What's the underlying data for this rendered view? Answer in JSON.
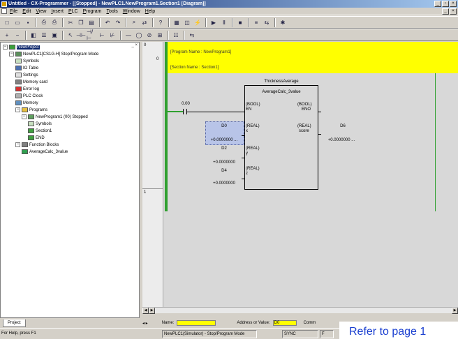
{
  "window": {
    "title": "Untitled - CX-Programmer - [[Stopped] - NewPLC1.NewProgram1.Section1 [Diagram]]"
  },
  "menu": [
    "File",
    "Edit",
    "View",
    "Insert",
    "PLC",
    "Program",
    "Tools",
    "Window",
    "Help"
  ],
  "toolbar1": [
    "new-icon",
    "open-icon",
    "save-icon",
    "sep",
    "print-preview-icon",
    "print-icon",
    "sep",
    "cut-icon",
    "copy-icon",
    "paste-icon",
    "sep",
    "undo-icon",
    "redo-icon",
    "sep",
    "find-icon",
    "replace-icon",
    "sep",
    "help-icon",
    "sep",
    "grid-icon",
    "monitor-icon",
    "online-icon",
    "sep",
    "run-icon",
    "pause-icon",
    "sep",
    "stop-icon",
    "sep",
    "compare-icon",
    "transfer-icon",
    "sep",
    "debug-icon"
  ],
  "toolbar2": [
    "zoom-in-icon",
    "zoom-out-icon",
    "sep",
    "view-icon",
    "list-icon",
    "watch-icon",
    "sep",
    "pointer-icon",
    "contact-no-icon",
    "contact-nc-icon",
    "or-no-icon",
    "or-nc-icon",
    "sep",
    "line-icon",
    "coil-icon",
    "coil-nc-icon",
    "instruction-icon",
    "sep",
    "network-icon",
    "sep",
    "transfer-icon"
  ],
  "project_tree": {
    "items": [
      {
        "label": "NewProject",
        "icon": "project-icon",
        "selected": true
      },
      {
        "label": "NewPLC1[CS1G-H] Stop/Program Mode",
        "icon": "plc-icon"
      },
      {
        "label": "Symbols",
        "icon": "symbols-icon"
      },
      {
        "label": "IO Table",
        "icon": "io-table-icon"
      },
      {
        "label": "Settings",
        "icon": "settings-icon"
      },
      {
        "label": "Memory card",
        "icon": "memory-card-icon"
      },
      {
        "label": "Error log",
        "icon": "error-log-icon"
      },
      {
        "label": "PLC Clock",
        "icon": "clock-icon"
      },
      {
        "label": "Memory",
        "icon": "memory-icon"
      },
      {
        "label": "Programs",
        "icon": "programs-icon"
      },
      {
        "label": "NewProgram1 (00) Stopped",
        "icon": "program-icon"
      },
      {
        "label": "Symbols",
        "icon": "symbols-icon"
      },
      {
        "label": "Section1",
        "icon": "section-icon"
      },
      {
        "label": "END",
        "icon": "end-icon"
      },
      {
        "label": "Function Blocks",
        "icon": "function-blocks-icon"
      },
      {
        "label": "AverageCalc_3value",
        "icon": "function-block-icon"
      }
    ]
  },
  "project_tab": "Project",
  "diagram": {
    "rung_numbers": [
      "0",
      "1"
    ],
    "step_label": "0",
    "program_name": "[Program Name : NewProgram1]",
    "section_name": "[Section Name : Section1]",
    "fb_instance": "ThicknessAverage",
    "fb_name": "AverageCalc_3value",
    "contact_address": "0.00",
    "inputs": [
      {
        "type": "(BOOL)",
        "name": "EN"
      },
      {
        "type": "(REAL)",
        "name": "x"
      },
      {
        "type": "(REAL)",
        "name": "y"
      },
      {
        "type": "(REAL)",
        "name": "z"
      }
    ],
    "outputs": [
      {
        "type": "(BOOL)",
        "name": "ENO"
      },
      {
        "type": "(REAL)",
        "name": "score"
      }
    ],
    "operands_in": [
      {
        "address": "D0",
        "value": "+0.0000000 ..."
      },
      {
        "address": "D2",
        "value": "+0.0000000"
      },
      {
        "address": "D4",
        "value": "+0.0000000"
      }
    ],
    "operand_out": {
      "address": "D6",
      "value": "+0.0000000 ..."
    }
  },
  "watch_bar": {
    "name_label": "Name:",
    "address_label": "Address or Value:",
    "address_value": "D0",
    "comment_label": "Comm"
  },
  "status": {
    "help": "For Help, press F1",
    "plc_status": "NewPLC1(Simulator) - Stop/Program Mode",
    "sync": "SYNC",
    "extra": "F"
  },
  "overlay_note": "Refer to page 1"
}
